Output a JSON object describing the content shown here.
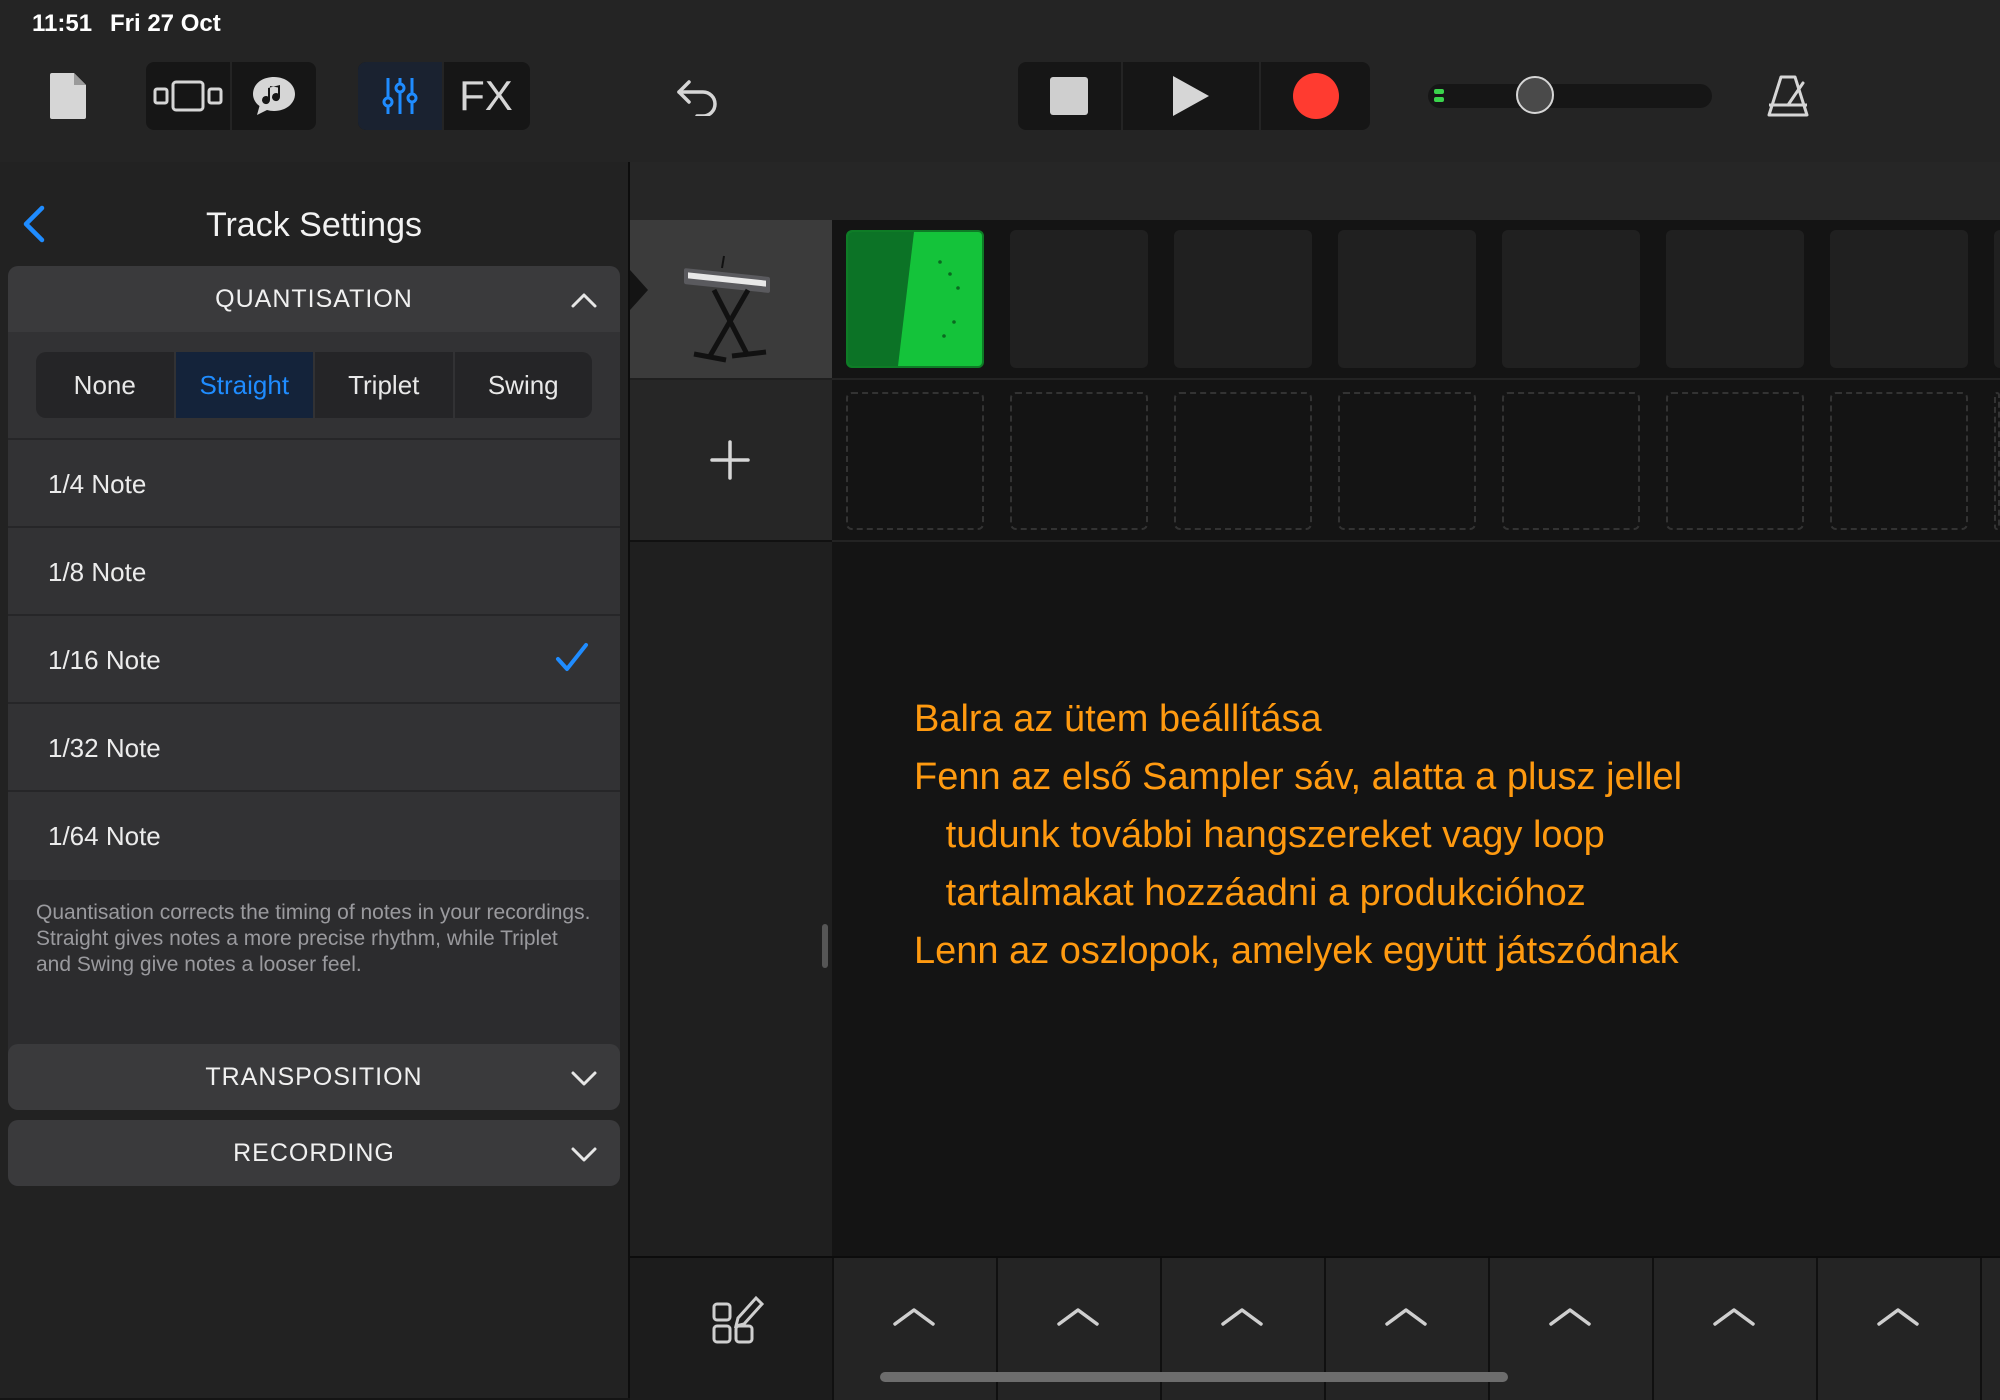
{
  "status": {
    "time": "11:51",
    "date": "Fri 27 Oct"
  },
  "toolbar": {
    "fx_label": "FX"
  },
  "panel": {
    "title": "Track Settings",
    "quantisation": {
      "header": "QUANTISATION",
      "segments": [
        "None",
        "Straight",
        "Triplet",
        "Swing"
      ],
      "selected_segment": "Straight",
      "notes": [
        "1/4 Note",
        "1/8 Note",
        "1/16 Note",
        "1/32 Note",
        "1/64 Note"
      ],
      "checked_note": "1/16 Note",
      "description": "Quantisation corrects the timing of notes in your recordings. Straight gives notes a more precise rhythm, while Triplet and Swing give notes a looser feel."
    },
    "transposition": {
      "header": "TRANSPOSITION"
    },
    "recording": {
      "header": "RECORDING"
    }
  },
  "overlay": {
    "lines": [
      "Balra az ütem beállítása",
      "Fenn az első Sampler sáv, alatta a plusz jellel",
      "   tudunk további hangszereket vagy loop",
      "   tartalmakat hozzáadni a produkcióhoz",
      "Lenn az oszlopok, amelyek együtt játszódnak"
    ]
  },
  "colors": {
    "accent": "#1f8cff",
    "record": "#ff3b30",
    "cell_active": "#14c33a",
    "overlay_text": "#ff9a10"
  }
}
